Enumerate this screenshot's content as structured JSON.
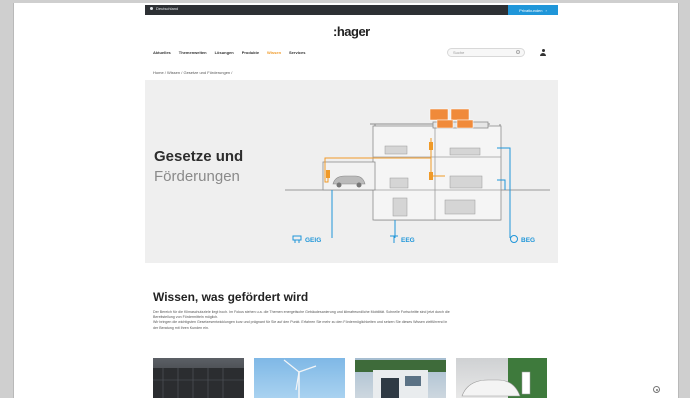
{
  "topbar": {
    "location": "Deutschland",
    "pro_button": "Privatkunden",
    "pro_arrow": "›"
  },
  "logo": ":hager",
  "nav": [
    "Aktuelles",
    "Themenwelten",
    "Lösungen",
    "Produkte",
    "Wissen",
    "Services"
  ],
  "nav_active_index": 4,
  "search": {
    "placeholder": "Suche"
  },
  "breadcrumb": "Home / Wissen / Gesetze und Förderungen /",
  "hero": {
    "title_line1": "Gesetze und",
    "title_line2": "Förderungen",
    "labels": {
      "geig": "GEIG",
      "eeg": "EEG",
      "beg": "BEG"
    }
  },
  "section": {
    "title": "Wissen, was gefördert wird",
    "paragraph1": "Der Bereich für die Klimaschutzziele liegt hoch. Im Fokus stehen u.a. die Themen energetische Gebäudesanierung und klimafreundliche Mobilität. Schnelle Fortschritte sind jetzt durch die Bereitstellung von Fördermitteln möglich.",
    "paragraph2": "Wir bringen die wichtigsten Gesetzesentwicklungen kurz und prägnant für Sie auf den Punkt. Erfahren Sie mehr zu den Fördermöglichkeiten und setzen Sie dieses Wissen zielführend in der Beratung mit Ihren Kunden ein."
  },
  "colors": {
    "accent_orange": "#f09a28",
    "accent_blue": "#1f96d9",
    "topbar": "#2d3034"
  }
}
